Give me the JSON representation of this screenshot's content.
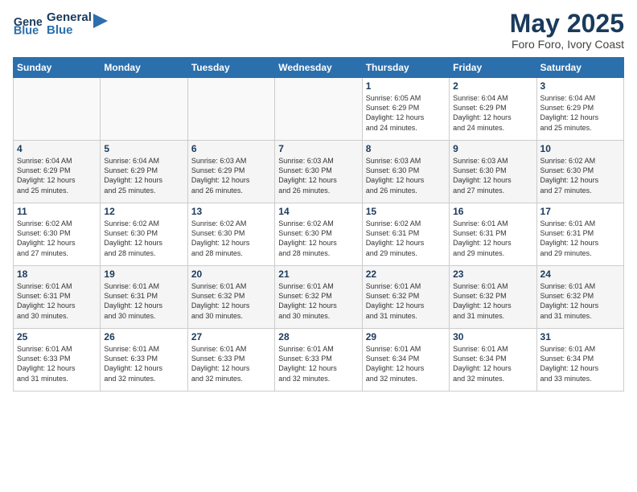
{
  "logo": {
    "line1": "General",
    "line2": "Blue"
  },
  "title": "May 2025",
  "location": "Foro Foro, Ivory Coast",
  "days_of_week": [
    "Sunday",
    "Monday",
    "Tuesday",
    "Wednesday",
    "Thursday",
    "Friday",
    "Saturday"
  ],
  "weeks": [
    [
      {
        "num": "",
        "info": ""
      },
      {
        "num": "",
        "info": ""
      },
      {
        "num": "",
        "info": ""
      },
      {
        "num": "",
        "info": ""
      },
      {
        "num": "1",
        "info": "Sunrise: 6:05 AM\nSunset: 6:29 PM\nDaylight: 12 hours\nand 24 minutes."
      },
      {
        "num": "2",
        "info": "Sunrise: 6:04 AM\nSunset: 6:29 PM\nDaylight: 12 hours\nand 24 minutes."
      },
      {
        "num": "3",
        "info": "Sunrise: 6:04 AM\nSunset: 6:29 PM\nDaylight: 12 hours\nand 25 minutes."
      }
    ],
    [
      {
        "num": "4",
        "info": "Sunrise: 6:04 AM\nSunset: 6:29 PM\nDaylight: 12 hours\nand 25 minutes."
      },
      {
        "num": "5",
        "info": "Sunrise: 6:04 AM\nSunset: 6:29 PM\nDaylight: 12 hours\nand 25 minutes."
      },
      {
        "num": "6",
        "info": "Sunrise: 6:03 AM\nSunset: 6:29 PM\nDaylight: 12 hours\nand 26 minutes."
      },
      {
        "num": "7",
        "info": "Sunrise: 6:03 AM\nSunset: 6:30 PM\nDaylight: 12 hours\nand 26 minutes."
      },
      {
        "num": "8",
        "info": "Sunrise: 6:03 AM\nSunset: 6:30 PM\nDaylight: 12 hours\nand 26 minutes."
      },
      {
        "num": "9",
        "info": "Sunrise: 6:03 AM\nSunset: 6:30 PM\nDaylight: 12 hours\nand 27 minutes."
      },
      {
        "num": "10",
        "info": "Sunrise: 6:02 AM\nSunset: 6:30 PM\nDaylight: 12 hours\nand 27 minutes."
      }
    ],
    [
      {
        "num": "11",
        "info": "Sunrise: 6:02 AM\nSunset: 6:30 PM\nDaylight: 12 hours\nand 27 minutes."
      },
      {
        "num": "12",
        "info": "Sunrise: 6:02 AM\nSunset: 6:30 PM\nDaylight: 12 hours\nand 28 minutes."
      },
      {
        "num": "13",
        "info": "Sunrise: 6:02 AM\nSunset: 6:30 PM\nDaylight: 12 hours\nand 28 minutes."
      },
      {
        "num": "14",
        "info": "Sunrise: 6:02 AM\nSunset: 6:30 PM\nDaylight: 12 hours\nand 28 minutes."
      },
      {
        "num": "15",
        "info": "Sunrise: 6:02 AM\nSunset: 6:31 PM\nDaylight: 12 hours\nand 29 minutes."
      },
      {
        "num": "16",
        "info": "Sunrise: 6:01 AM\nSunset: 6:31 PM\nDaylight: 12 hours\nand 29 minutes."
      },
      {
        "num": "17",
        "info": "Sunrise: 6:01 AM\nSunset: 6:31 PM\nDaylight: 12 hours\nand 29 minutes."
      }
    ],
    [
      {
        "num": "18",
        "info": "Sunrise: 6:01 AM\nSunset: 6:31 PM\nDaylight: 12 hours\nand 30 minutes."
      },
      {
        "num": "19",
        "info": "Sunrise: 6:01 AM\nSunset: 6:31 PM\nDaylight: 12 hours\nand 30 minutes."
      },
      {
        "num": "20",
        "info": "Sunrise: 6:01 AM\nSunset: 6:32 PM\nDaylight: 12 hours\nand 30 minutes."
      },
      {
        "num": "21",
        "info": "Sunrise: 6:01 AM\nSunset: 6:32 PM\nDaylight: 12 hours\nand 30 minutes."
      },
      {
        "num": "22",
        "info": "Sunrise: 6:01 AM\nSunset: 6:32 PM\nDaylight: 12 hours\nand 31 minutes."
      },
      {
        "num": "23",
        "info": "Sunrise: 6:01 AM\nSunset: 6:32 PM\nDaylight: 12 hours\nand 31 minutes."
      },
      {
        "num": "24",
        "info": "Sunrise: 6:01 AM\nSunset: 6:32 PM\nDaylight: 12 hours\nand 31 minutes."
      }
    ],
    [
      {
        "num": "25",
        "info": "Sunrise: 6:01 AM\nSunset: 6:33 PM\nDaylight: 12 hours\nand 31 minutes."
      },
      {
        "num": "26",
        "info": "Sunrise: 6:01 AM\nSunset: 6:33 PM\nDaylight: 12 hours\nand 32 minutes."
      },
      {
        "num": "27",
        "info": "Sunrise: 6:01 AM\nSunset: 6:33 PM\nDaylight: 12 hours\nand 32 minutes."
      },
      {
        "num": "28",
        "info": "Sunrise: 6:01 AM\nSunset: 6:33 PM\nDaylight: 12 hours\nand 32 minutes."
      },
      {
        "num": "29",
        "info": "Sunrise: 6:01 AM\nSunset: 6:34 PM\nDaylight: 12 hours\nand 32 minutes."
      },
      {
        "num": "30",
        "info": "Sunrise: 6:01 AM\nSunset: 6:34 PM\nDaylight: 12 hours\nand 32 minutes."
      },
      {
        "num": "31",
        "info": "Sunrise: 6:01 AM\nSunset: 6:34 PM\nDaylight: 12 hours\nand 33 minutes."
      }
    ]
  ]
}
